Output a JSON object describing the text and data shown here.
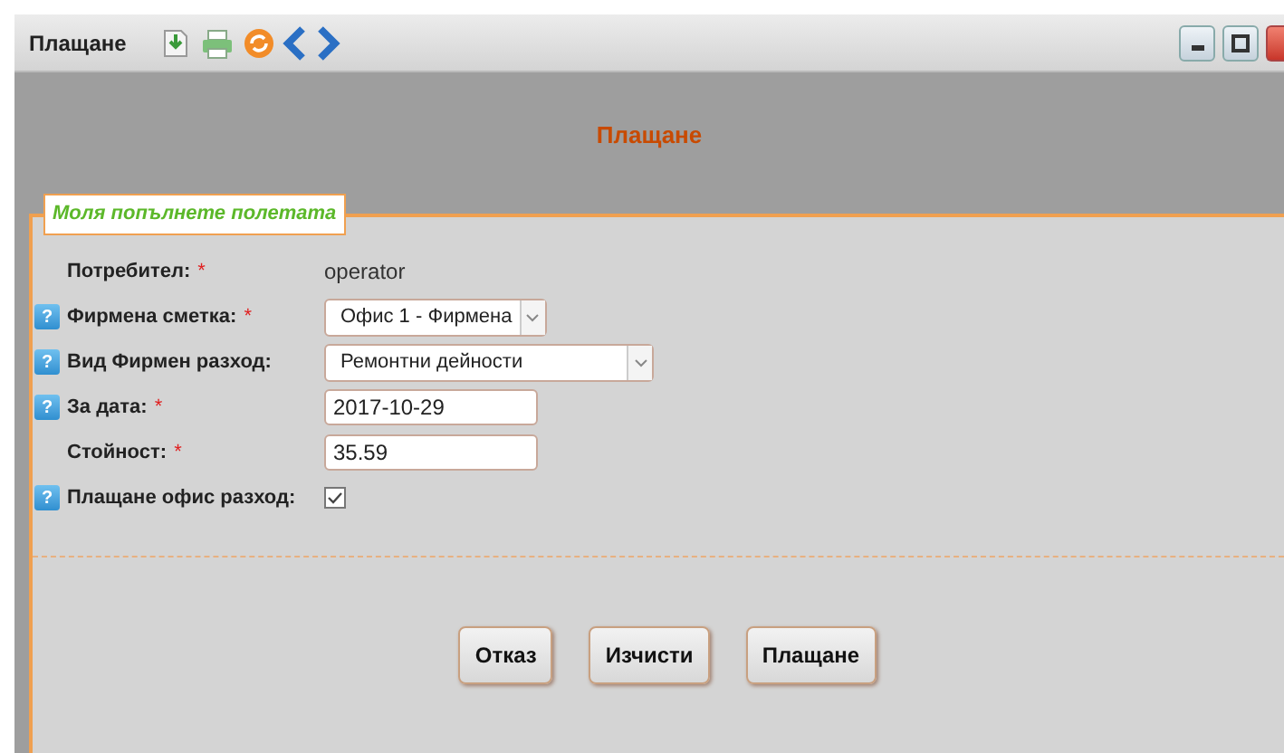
{
  "window": {
    "title": "Плащане"
  },
  "header": {
    "title": "Плащане"
  },
  "form": {
    "legend": "Моля попълнете полетата",
    "rows": [
      {
        "kind": "text",
        "label": "Потребител:",
        "required_mark": "*",
        "value": "operator"
      },
      {
        "kind": "select",
        "label": "Фирмена сметка:",
        "required_mark": "*",
        "help_icon": "?",
        "value": "Офис 1 - Фирмена",
        "wide": false
      },
      {
        "kind": "select",
        "label": "Вид Фирмен разход:",
        "help_icon": "?",
        "value": "Ремонтни дейности",
        "wide": true
      },
      {
        "kind": "input",
        "label": "За дата:",
        "required_mark": "*",
        "help_icon": "?",
        "value": "2017-10-29"
      },
      {
        "kind": "input",
        "label": "Стойност:",
        "required_mark": "*",
        "value": "35.59"
      },
      {
        "kind": "checkbox",
        "label": "Плащане офис разход:",
        "help_icon": "?",
        "checked": true
      }
    ],
    "buttons": [
      "Отказ",
      "Изчисти",
      "Плащане"
    ]
  }
}
